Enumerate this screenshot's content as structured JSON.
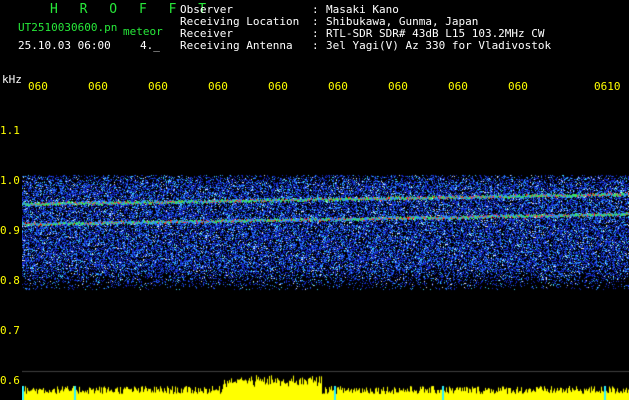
{
  "header": {
    "brand": "H R O F F T",
    "filename": "UT2510030600.pn",
    "mode": "meteor",
    "datetime": "25.10.03 06:00",
    "counter": "4._",
    "info": [
      {
        "label": "Observer",
        "value": "Masaki Kano"
      },
      {
        "label": "Receiving Location",
        "value": "Shibukawa, Gunma, Japan"
      },
      {
        "label": "Receiver",
        "value": "RTL-SDR SDR# 43dB L15 103.2MHz CW"
      },
      {
        "label": "Receiving Antenna",
        "value": "3el Yagi(V) Az 330 for Vladivostok"
      }
    ],
    "separator": ":"
  },
  "axes": {
    "y_unit": "kHz",
    "y_ticks": [
      "1.1",
      "1.0",
      "0.9",
      "0.8",
      "0.7",
      "0.6"
    ],
    "x_ticks": [
      "060",
      "060",
      "060",
      "060",
      "060",
      "060",
      "060",
      "060",
      "060",
      "0610"
    ]
  },
  "colors": {
    "label_green": "#27e83a",
    "label_white": "#ffffff",
    "axis_yellow": "#ffff00",
    "background": "#000000",
    "signal_red": "#ff2a2a",
    "noise_blue": "#1f3cff"
  }
}
